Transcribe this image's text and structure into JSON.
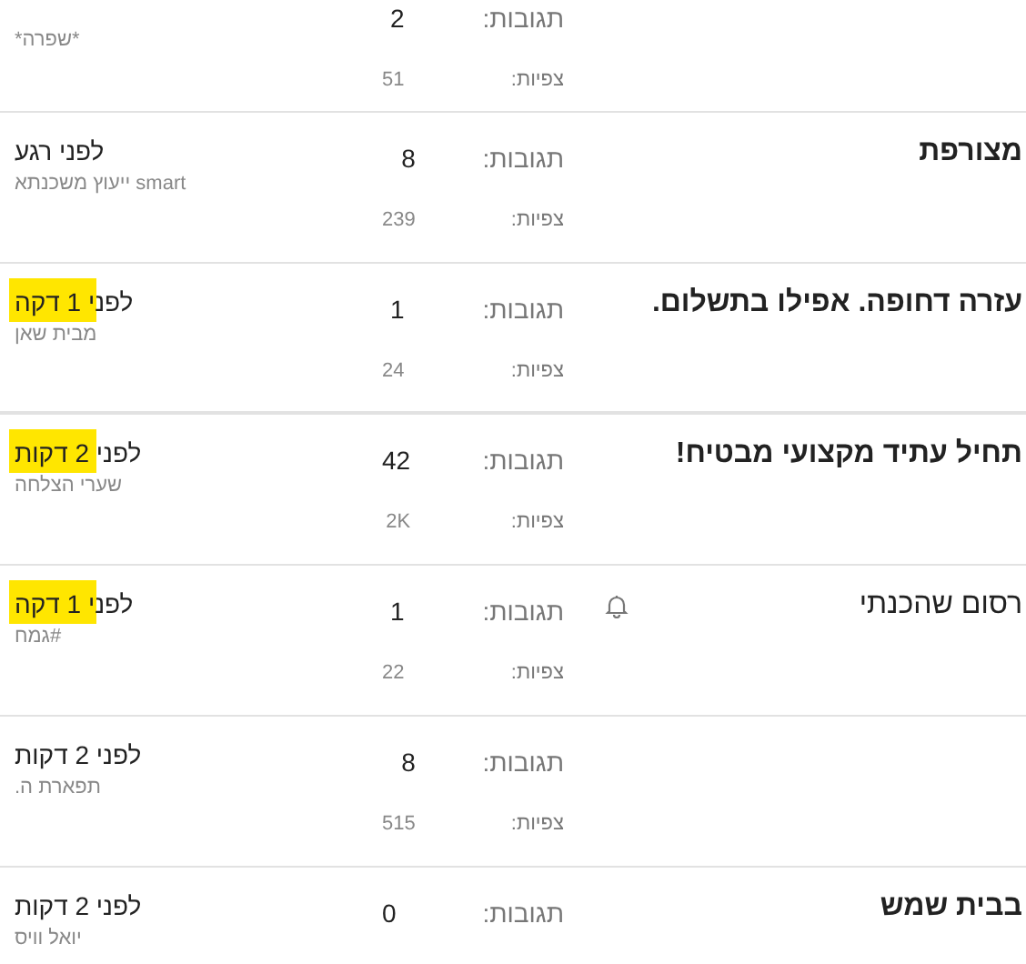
{
  "threads": [
    {
      "bell": false,
      "highlighted": false,
      "author": "*שפרה*",
      "replies_label": "תגובות:",
      "replies": "2",
      "views_label": "צפיות:",
      "views": "51"
    },
    {
      "title": "מצורפת",
      "bold": true,
      "bell": false,
      "time": "לפני רגע",
      "highlighted": false,
      "author": "smart ייעוץ משכנתא",
      "replies_label": "תגובות:",
      "replies": "8",
      "views_label": "צפיות:",
      "views": "239"
    },
    {
      "title": "עזרה דחופה. אפילו בתשלום.",
      "bold": true,
      "bell": false,
      "time": "לפני 1 דקה",
      "highlighted": true,
      "author": "מבית שאן",
      "replies_label": "תגובות:",
      "replies": "1",
      "views_label": "צפיות:",
      "views": "24"
    },
    {
      "title": "תחיל עתיד מקצועי מבטיח!",
      "bold": true,
      "bell": false,
      "time": "לפני 2 דקות",
      "highlighted": true,
      "author": "שערי הצלחה",
      "replies_label": "תגובות:",
      "replies": "42",
      "views_label": "צפיות:",
      "views": "2K"
    },
    {
      "title": "רסום שהכנתי",
      "bold": false,
      "bell": true,
      "time": "לפני 1 דקה",
      "highlighted": true,
      "author": "#גמח",
      "replies_label": "תגובות:",
      "replies": "1",
      "views_label": "צפיות:",
      "views": "22"
    },
    {
      "bell": false,
      "time": "לפני 2 דקות",
      "highlighted": false,
      "author": "תפארת ה.",
      "replies_label": "תגובות:",
      "replies": "8",
      "views_label": "צפיות:",
      "views": "515"
    },
    {
      "title": "בבית שמש",
      "bold": true,
      "bell": false,
      "time": "לפני 2 דקות",
      "highlighted": false,
      "author": "יואל וויס",
      "replies_label": "תגובות:",
      "replies": "0"
    }
  ]
}
